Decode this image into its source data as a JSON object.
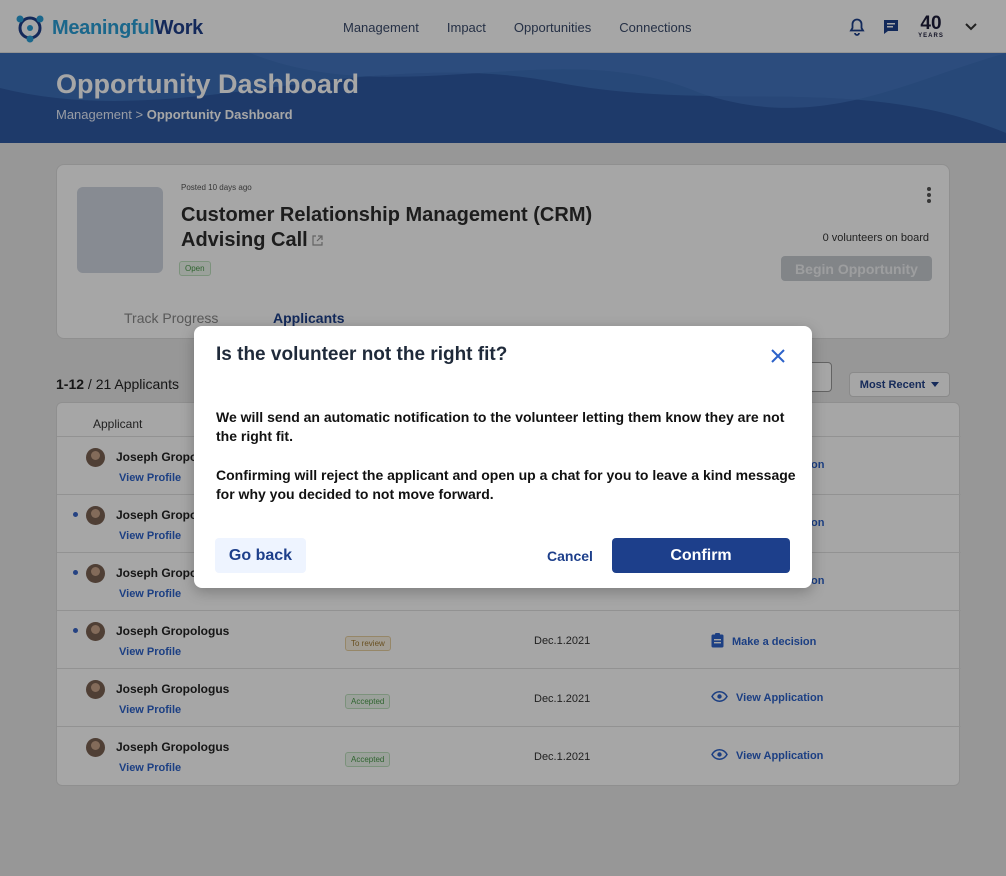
{
  "nav": {
    "logo_part1": "Meaningful",
    "logo_part2": "Work",
    "links": [
      "Management",
      "Impact",
      "Opportunities",
      "Connections"
    ],
    "badge_number": "40",
    "badge_text": "YEARS"
  },
  "hero": {
    "title": "Opportunity Dashboard",
    "crumb_parent": "Management",
    "crumb_separator": ">",
    "crumb_current": "Opportunity Dashboard"
  },
  "opportunity": {
    "posted": "Posted 10 days ago",
    "title": "Customer Relationship Management (CRM) Advising Call",
    "status": "Open",
    "volunteers": "0 volunteers on board",
    "begin_label": "Begin Opportunity",
    "tabs": [
      "Track Progress",
      "Applicants"
    ]
  },
  "applicants": {
    "range": "1-12",
    "total": "/ 21 Applicants",
    "sort_label": "Most Recent",
    "header_applicant": "Applicant",
    "rows": [
      {
        "name": "Joseph Gropo",
        "profile": "View Profile",
        "dot": false,
        "frag": "on"
      },
      {
        "name": "Joseph Gropo",
        "profile": "View Profile",
        "dot": true,
        "frag": "on"
      },
      {
        "name": "Joseph Gropo",
        "profile": "View Profile",
        "dot": true,
        "frag": "on"
      },
      {
        "name": "Joseph Gropologus",
        "profile": "View Profile",
        "dot": true,
        "status": "To review",
        "status_type": "review",
        "date": "Dec.1.2021",
        "action": "Make a decision",
        "action_icon": "clipboard-icon"
      },
      {
        "name": "Joseph Gropologus",
        "profile": "View Profile",
        "dot": false,
        "status": "Accepted",
        "status_type": "accepted",
        "date": "Dec.1.2021",
        "action": "View Application",
        "action_icon": "eye-icon"
      },
      {
        "name": "Joseph Gropologus",
        "profile": "View Profile",
        "dot": false,
        "status": "Accepted",
        "status_type": "accepted",
        "date": "Dec.1.2021",
        "action": "View Application",
        "action_icon": "eye-icon"
      }
    ]
  },
  "modal": {
    "title": "Is the volunteer not the right fit?",
    "paragraph1": "We will send an automatic notification to the volunteer letting them know they are not the right fit.",
    "paragraph2": "Confirming will  reject the applicant and open up a chat for you to leave a kind message for why you decided to not move forward.",
    "back_label": "Go back",
    "cancel_label": "Cancel",
    "confirm_label": "Confirm"
  },
  "colors": {
    "brand_blue": "#1d3f8b",
    "brand_light": "#2a9fd6",
    "hero_blue": "#3d6fb8",
    "link_blue": "#2c62c9"
  }
}
